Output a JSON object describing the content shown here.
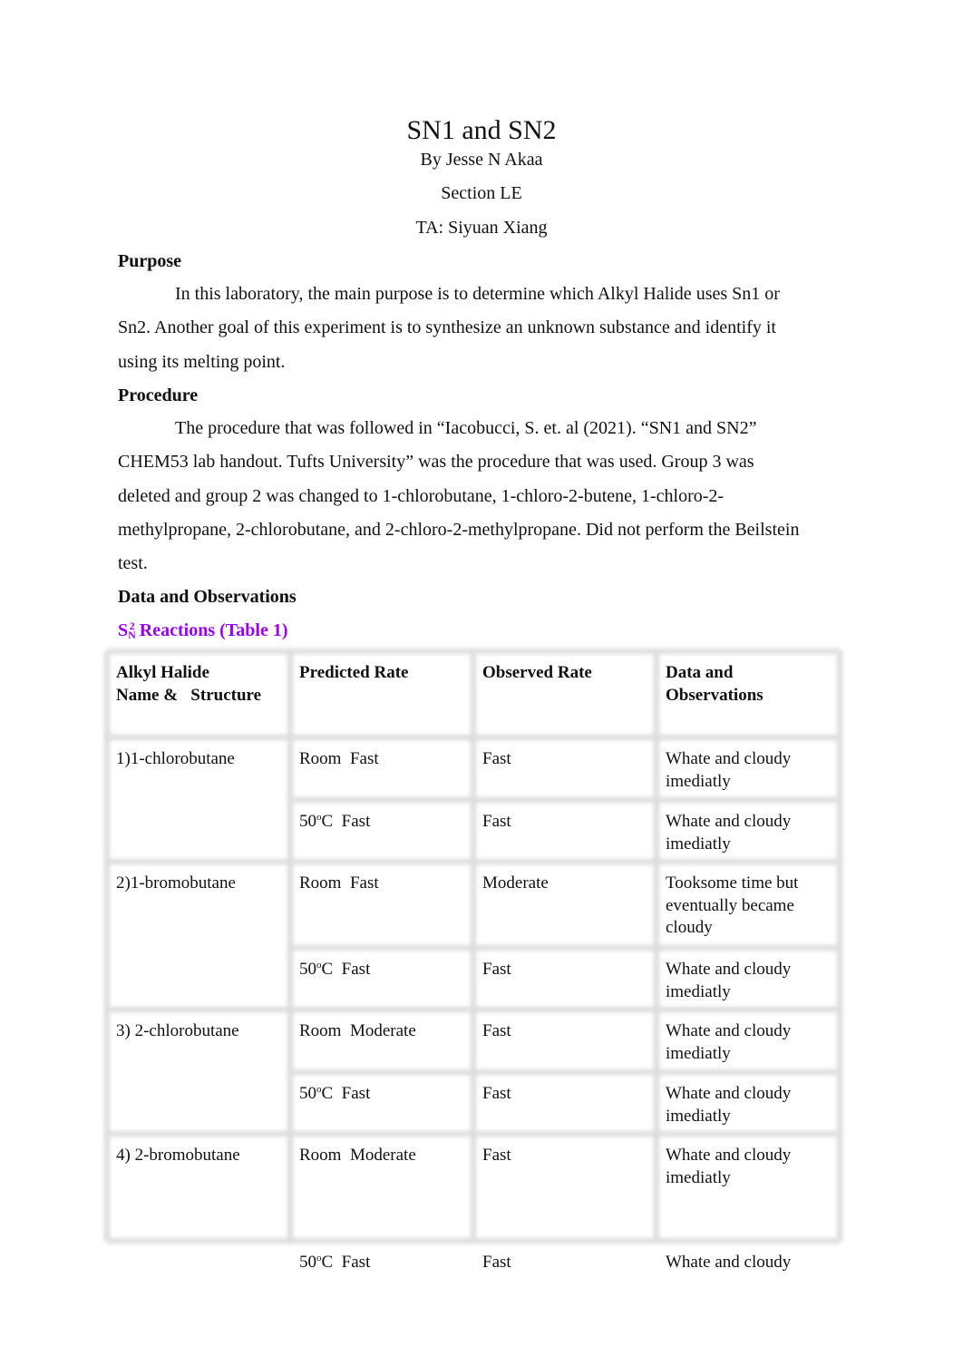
{
  "document": {
    "title": "SN1 and SN2",
    "author": "By Jesse N Akaa",
    "section": "Section LE",
    "ta": "TA: Siyuan Xiang"
  },
  "purpose": {
    "heading": "Purpose",
    "lines": [
      "In this laboratory, the main purpose is to determine which Alkyl Halide uses Sn1 or",
      "Sn2. Another goal of this experiment is to synthesize an unknown substance and identify it",
      "using its melting point."
    ]
  },
  "procedure": {
    "heading": "Procedure",
    "lines": [
      "The procedure that was followed in “Iacobucci, S. et. al (2021). “SN1 and SN2”",
      "CHEM53 lab handout. Tufts University” was the procedure that was used. Group 3 was",
      "deleted and  group 2 was changed to 1-chlorobutane, 1-chloro-2-butene, 1-chloro-2-",
      "methylpropane, 2-chlorobutane, and 2-chloro-2-methylpropane. Did not perform the Beilstein",
      "test."
    ]
  },
  "data_section": {
    "heading": "Data and Observations",
    "table_title": {
      "prefix": "S",
      "sub": "N",
      "sup": "2",
      "text": " Reactions (Table 1)",
      "color": "#9a00ff"
    }
  },
  "table": {
    "headers": [
      [
        "Alkyl Halide",
        "Name &   Structure"
      ],
      [
        "Predicted Rate"
      ],
      [
        "Observed Rate"
      ],
      [
        "Data and",
        "Observations"
      ]
    ],
    "rows": [
      {
        "halide": "1)1-chlorobutane",
        "predicted_cond": "Room",
        "predicted_rate": "Fast",
        "observed": "Fast",
        "notes": [
          "Whate and cloudy",
          "imediatly"
        ]
      },
      {
        "halide": "",
        "predicted_cond": "50",
        "degree": "o",
        "predicted_unit": "C",
        "predicted_rate": "Fast",
        "observed": "Fast",
        "notes": [
          "Whate and cloudy",
          "imediatly"
        ]
      },
      {
        "halide": "2)1-bromobutane",
        "predicted_cond": "Room",
        "predicted_rate": "Fast",
        "observed": "Moderate",
        "notes": [
          "Tooksome time but",
          "eventually became",
          "cloudy"
        ]
      },
      {
        "halide": "",
        "predicted_cond": "50",
        "degree": "o",
        "predicted_unit": "C",
        "predicted_rate": "Fast",
        "observed": "Fast",
        "notes": [
          "Whate and cloudy",
          "imediatly"
        ]
      },
      {
        "halide": "3) 2-chlorobutane",
        "predicted_cond": "Room",
        "predicted_rate": "Moderate",
        "observed": "Fast",
        "notes": [
          "Whate and cloudy",
          "imediatly"
        ]
      },
      {
        "halide": "",
        "predicted_cond": "50",
        "degree": "o",
        "predicted_unit": "C",
        "predicted_rate": "Fast",
        "observed": "Fast",
        "notes": [
          "Whate and cloudy",
          "imediatly"
        ]
      },
      {
        "halide": "4) 2-bromobutane",
        "predicted_cond": "Room",
        "predicted_rate": "Moderate",
        "observed": "Fast",
        "notes": [
          "Whate and cloudy",
          "imediatly"
        ]
      },
      {
        "halide": "",
        "predicted_cond": "50",
        "degree": "o",
        "predicted_unit": "C",
        "predicted_rate": "Fast",
        "observed": "Fast",
        "notes": [
          "Whate and cloudy"
        ]
      }
    ]
  }
}
